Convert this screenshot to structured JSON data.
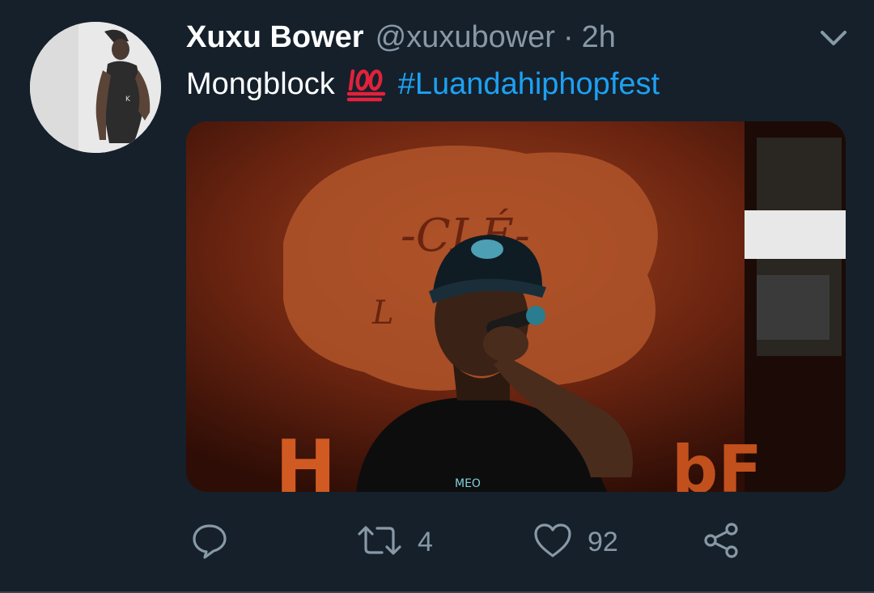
{
  "tweet": {
    "display_name": "Xuxu Bower",
    "handle": "@xuxubower",
    "separator": "·",
    "timestamp": "2h",
    "text": "Mongblock",
    "emoji": "hundred-points-icon",
    "hashtag": "#Luandahiphopfest"
  },
  "actions": {
    "reply": {
      "icon": "reply-icon",
      "count": ""
    },
    "retweet": {
      "icon": "retweet-icon",
      "count": "4"
    },
    "like": {
      "icon": "heart-icon",
      "count": "92"
    },
    "share": {
      "icon": "share-icon"
    }
  },
  "colors": {
    "background": "#15202b",
    "text": "#ffffff",
    "secondary": "#8899a6",
    "link": "#1da1f2",
    "emoji_red": "#e0223c"
  }
}
